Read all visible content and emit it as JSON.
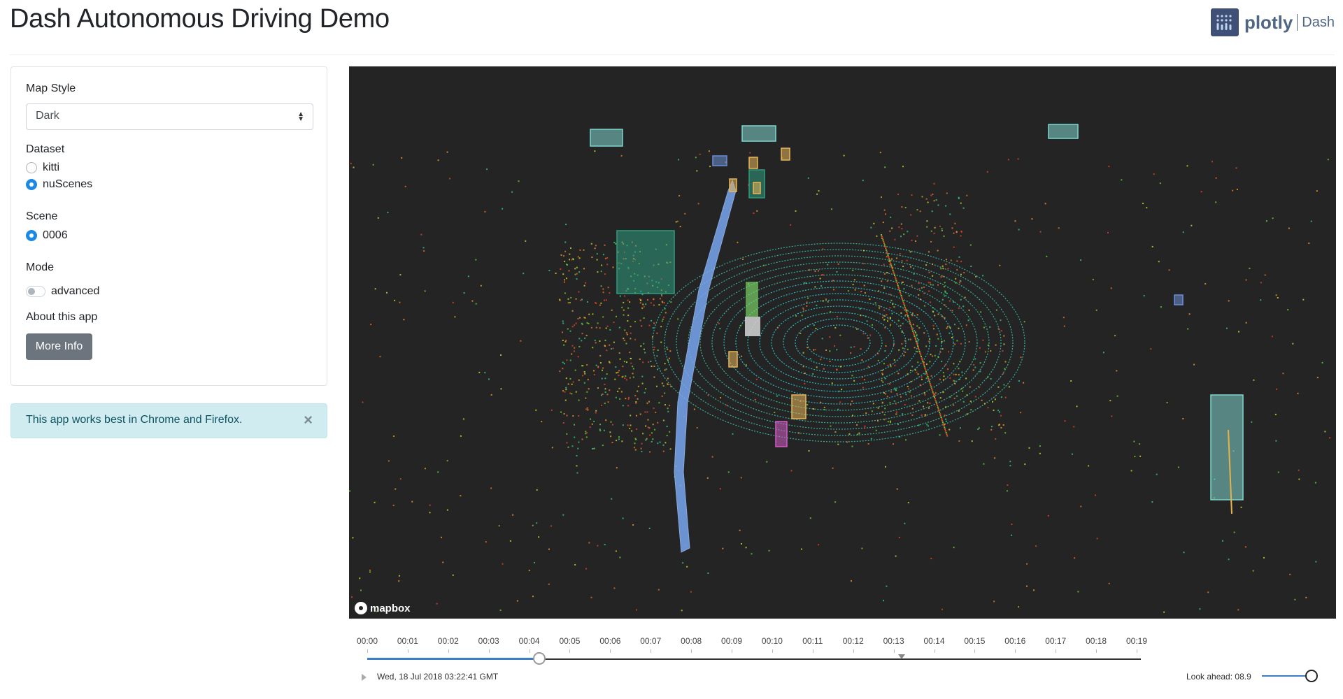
{
  "header": {
    "title": "Dash Autonomous Driving Demo",
    "brand_plotly": "plotly",
    "brand_dash": "Dash"
  },
  "controls": {
    "map_style": {
      "label": "Map Style",
      "selected": "Dark"
    },
    "dataset": {
      "label": "Dataset",
      "options": [
        {
          "label": "kitti",
          "checked": false
        },
        {
          "label": "nuScenes",
          "checked": true
        }
      ]
    },
    "scene": {
      "label": "Scene",
      "options": [
        {
          "label": "0006",
          "checked": true
        }
      ]
    },
    "mode": {
      "label": "Mode",
      "toggle_label": "advanced",
      "on": false
    },
    "about": {
      "label": "About this app",
      "button": "More Info"
    }
  },
  "alert": {
    "text": "This app works best in Chrome and Firefox.",
    "close": "×"
  },
  "viewer": {
    "attribution": "mapbox",
    "colors": {
      "background": "#242424",
      "car_box": "#7fd6cf",
      "large_vehicle": "#2f9c7d",
      "pedestrian": "#e7b65a",
      "cyclist": "#6b8fd6",
      "ego_path": "#79a7f0",
      "ego_vehicle": "#cccccc",
      "barrier": "#d45cc6"
    }
  },
  "timeline": {
    "ticks": [
      "00:00",
      "00:01",
      "00:02",
      "00:03",
      "00:04",
      "00:05",
      "00:06",
      "00:07",
      "00:08",
      "00:09",
      "00:10",
      "00:11",
      "00:12",
      "00:13",
      "00:14",
      "00:15",
      "00:16",
      "00:17",
      "00:18",
      "00:19"
    ],
    "current_seconds": 4.25,
    "buffer_seconds": 13.2,
    "duration_seconds": 19.1,
    "timestamp": "Wed, 18 Jul 2018 03:22:41 GMT",
    "lookahead_label": "Look ahead: 08.9",
    "lookahead_value": 8.9,
    "lookahead_fraction": 1.0
  }
}
